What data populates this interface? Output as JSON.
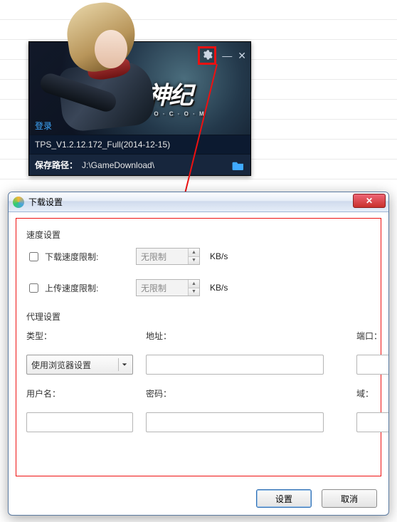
{
  "launcher": {
    "login_label": "登录",
    "package_name": "TPS_V1.2.12.172_Full(2014-12-15)",
    "save_path_label": "保存路径：",
    "save_path_value": "J:\\GameDownload\\",
    "game_logo": "枪神纪",
    "game_logo_sub": "T P S · O · C · O · M"
  },
  "dialog": {
    "title": "下载设置",
    "speed": {
      "section": "速度设置",
      "download_label": "下载速度限制:",
      "upload_label": "上传速度限制:",
      "nolimit": "无限制",
      "unit": "KB/s"
    },
    "proxy": {
      "section": "代理设置",
      "type_label": "类型：",
      "addr_label": "地址：",
      "port_label": "端口：",
      "user_label": "用户名：",
      "pass_label": "密码：",
      "domain_label": "域：",
      "type_value": "使用浏览器设置",
      "addr_value": "",
      "port_value": "",
      "user_value": "",
      "pass_value": "",
      "domain_value": ""
    },
    "buttons": {
      "ok": "设置",
      "cancel": "取消"
    }
  }
}
